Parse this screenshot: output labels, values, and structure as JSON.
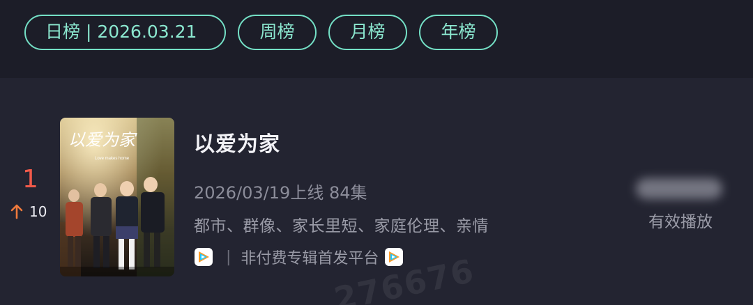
{
  "tabs": [
    {
      "label": "日榜 | 2026.03.21",
      "active": true
    },
    {
      "label": "周榜"
    },
    {
      "label": "月榜"
    },
    {
      "label": "年榜"
    }
  ],
  "accent_color": "#74e0c6",
  "entry": {
    "rank": "1",
    "rank_change": "10",
    "rank_change_direction": "up",
    "rank_color": "#f15a4a",
    "poster": {
      "title_text": "以爱为家",
      "subtitle_text": "Love makes home"
    },
    "title": "以爱为家",
    "release_info": "2026/03/19上线 84集",
    "genres": "都市、群像、家长里短、家庭伦理、亲情",
    "platform_icon": "tencent-video-icon",
    "platform_text": "非付费专辑首发平台",
    "separator": "|",
    "stat_label": "有效播放"
  },
  "watermark": "276676"
}
